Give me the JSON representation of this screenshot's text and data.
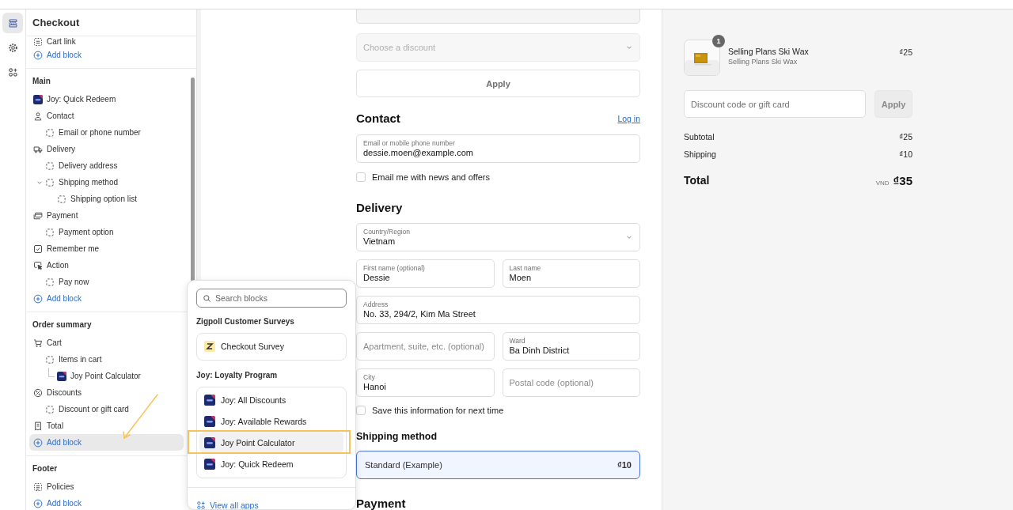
{
  "rail": [
    {
      "kind": "sections",
      "selected": true
    },
    {
      "kind": "settings",
      "selected": false
    },
    {
      "kind": "apps",
      "selected": false
    }
  ],
  "sidebar": {
    "title": "Checkout",
    "sections": [
      {
        "items": [
          {
            "label": "Cart link",
            "kind": "cartlink"
          }
        ],
        "add_block": {
          "label": "Add block",
          "selected": false
        }
      },
      {
        "heading": "Main",
        "items": [
          {
            "label": "Joy: Quick Redeem",
            "kind": "joy"
          },
          {
            "label": "Contact",
            "kind": "person",
            "children": [
              {
                "label": "Email or phone number",
                "kind": "block"
              }
            ]
          },
          {
            "label": "Delivery",
            "kind": "truck",
            "children": [
              {
                "label": "Delivery address",
                "kind": "block"
              },
              {
                "label": "Shipping method",
                "kind": "block",
                "expanded": true,
                "children": [
                  {
                    "label": "Shipping option list",
                    "kind": "block"
                  }
                ]
              }
            ]
          },
          {
            "label": "Payment",
            "kind": "payment",
            "children": [
              {
                "label": "Payment option",
                "kind": "block"
              }
            ]
          },
          {
            "label": "Remember me",
            "kind": "checkbox"
          },
          {
            "label": "Action",
            "kind": "cursor",
            "children": [
              {
                "label": "Pay now",
                "kind": "block"
              }
            ]
          }
        ],
        "add_block": {
          "label": "Add block",
          "selected": false
        }
      },
      {
        "heading": "Order summary",
        "items": [
          {
            "label": "Cart",
            "kind": "cart",
            "children": [
              {
                "label": "Items in cart",
                "kind": "block",
                "children": [
                  {
                    "label": "Joy Point Calculator",
                    "kind": "joy"
                  }
                ]
              }
            ]
          },
          {
            "label": "Discounts",
            "kind": "discount",
            "children": [
              {
                "label": "Discount or gift card",
                "kind": "block"
              }
            ]
          },
          {
            "label": "Total",
            "kind": "receipt"
          }
        ],
        "add_block": {
          "label": "Add block",
          "selected": true
        }
      },
      {
        "heading": "Footer",
        "items": [
          {
            "label": "Policies",
            "kind": "policies"
          }
        ],
        "add_block": {
          "label": "Add block",
          "selected": false
        }
      }
    ]
  },
  "block_picker": {
    "search": {
      "placeholder": "Search blocks"
    },
    "groups": [
      {
        "title": "Zigpoll Customer Surveys",
        "items": [
          {
            "label": "Checkout Survey",
            "kind": "zigpoll",
            "highlighted": false
          }
        ]
      },
      {
        "title": "Joy: Loyalty Program",
        "items": [
          {
            "label": "Joy: All Discounts",
            "kind": "joy",
            "highlighted": false
          },
          {
            "label": "Joy: Available Rewards",
            "kind": "joy",
            "highlighted": false
          },
          {
            "label": "Joy Point Calculator",
            "kind": "joy",
            "highlighted": true
          },
          {
            "label": "Joy: Quick Redeem",
            "kind": "joy",
            "highlighted": false
          }
        ]
      }
    ],
    "footer_link": "View all apps"
  },
  "checkout": {
    "discount_select": {
      "placeholder": "Choose a discount",
      "disabled": true
    },
    "apply_button": "Apply",
    "contact": {
      "heading": "Contact",
      "login_link": "Log in",
      "email": {
        "label": "Email or mobile phone number",
        "value": "dessie.moen@example.com"
      },
      "news_checkbox": {
        "label": "Email me with news and offers",
        "checked": false
      }
    },
    "delivery": {
      "heading": "Delivery",
      "rows": [
        [
          {
            "label": "Country/Region",
            "value": "Vietnam",
            "kind": "select"
          }
        ],
        [
          {
            "label": "First name (optional)",
            "value": "Dessie",
            "kind": "text"
          },
          {
            "label": "Last name",
            "value": "Moen",
            "kind": "text"
          }
        ],
        [
          {
            "label": "Address",
            "value": "No. 33, 294/2, Kim Ma Street",
            "kind": "text"
          }
        ],
        [
          {
            "placeholder": "Apartment, suite, etc. (optional)",
            "kind": "text"
          },
          {
            "label": "Ward",
            "value": "Ba Dinh District",
            "kind": "text"
          }
        ],
        [
          {
            "label": "City",
            "value": "Hanoi",
            "kind": "text"
          },
          {
            "placeholder": "Postal code (optional)",
            "kind": "text"
          }
        ]
      ],
      "save_checkbox": {
        "label": "Save this information for next time",
        "checked": false
      }
    },
    "shipping": {
      "heading": "Shipping method",
      "options": [
        {
          "label": "Standard (Example)",
          "price": "₫10",
          "selected": true
        }
      ]
    },
    "payment": {
      "heading": "Payment"
    }
  },
  "summary": {
    "items": [
      {
        "name": "Selling Plans Ski Wax",
        "variant": "Selling Plans Ski Wax",
        "price": "₫25",
        "quantity": "1"
      }
    ],
    "discount": {
      "placeholder": "Discount code or gift card",
      "button": "Apply"
    },
    "lines": [
      {
        "label": "Subtotal",
        "value": "₫25"
      },
      {
        "label": "Shipping",
        "value": "₫10"
      }
    ],
    "total": {
      "label": "Total",
      "currency": "VND",
      "value": "₫35"
    }
  }
}
